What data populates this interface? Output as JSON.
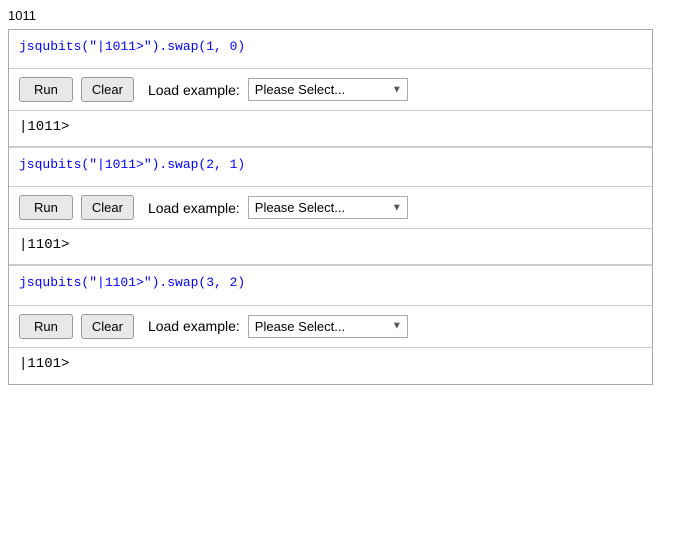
{
  "page": {
    "title": "1011"
  },
  "blocks": [
    {
      "id": "block1",
      "code": "jsqubits(\"|1011>\").swap(1, 0)",
      "run_label": "Run",
      "clear_label": "Clear",
      "load_example_label": "Load example:",
      "select_placeholder": "Please Select...",
      "output": "|1011>"
    },
    {
      "id": "block2",
      "code": "jsqubits(\"|1011>\").swap(2, 1)",
      "run_label": "Run",
      "clear_label": "Clear",
      "load_example_label": "Load example:",
      "select_placeholder": "Please Select...",
      "output": "|1101>"
    },
    {
      "id": "block3",
      "code": "jsqubits(\"|1101>\").swap(3, 2)",
      "run_label": "Run",
      "clear_label": "Clear",
      "load_example_label": "Load example:",
      "select_placeholder": "Please Select...",
      "output": "|1101>"
    }
  ]
}
